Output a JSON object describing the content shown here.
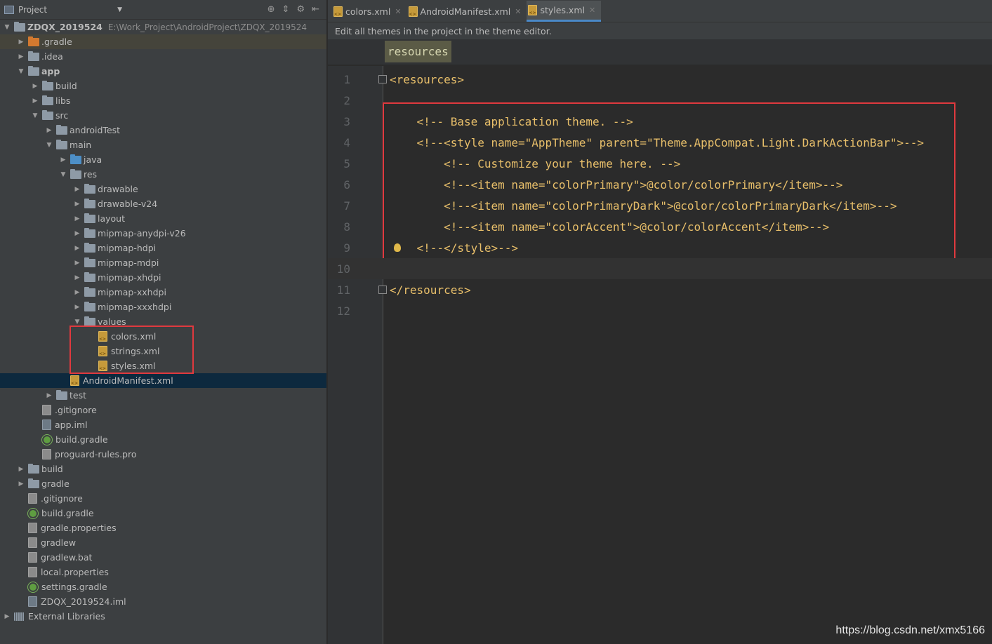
{
  "project_panel": {
    "title": "Project",
    "tree": [
      {
        "label": "ZDQX_2019524",
        "path": "E:\\Work_Project\\AndroidProject\\ZDQX_2019524",
        "depth": 0,
        "arrow": "down",
        "icon": "module",
        "bold": true
      },
      {
        "label": ".gradle",
        "depth": 1,
        "arrow": "right",
        "icon": "folder-orange",
        "highlight": true
      },
      {
        "label": ".idea",
        "depth": 1,
        "arrow": "right",
        "icon": "folder"
      },
      {
        "label": "app",
        "depth": 1,
        "arrow": "down",
        "icon": "folder-module",
        "bold": true
      },
      {
        "label": "build",
        "depth": 2,
        "arrow": "right",
        "icon": "folder"
      },
      {
        "label": "libs",
        "depth": 2,
        "arrow": "right",
        "icon": "folder"
      },
      {
        "label": "src",
        "depth": 2,
        "arrow": "down",
        "icon": "folder"
      },
      {
        "label": "androidTest",
        "depth": 3,
        "arrow": "right",
        "icon": "folder"
      },
      {
        "label": "main",
        "depth": 3,
        "arrow": "down",
        "icon": "folder"
      },
      {
        "label": "java",
        "depth": 4,
        "arrow": "right",
        "icon": "folder-blue"
      },
      {
        "label": "res",
        "depth": 4,
        "arrow": "down",
        "icon": "folder-res"
      },
      {
        "label": "drawable",
        "depth": 5,
        "arrow": "right",
        "icon": "folder"
      },
      {
        "label": "drawable-v24",
        "depth": 5,
        "arrow": "right",
        "icon": "folder"
      },
      {
        "label": "layout",
        "depth": 5,
        "arrow": "right",
        "icon": "folder"
      },
      {
        "label": "mipmap-anydpi-v26",
        "depth": 5,
        "arrow": "right",
        "icon": "folder"
      },
      {
        "label": "mipmap-hdpi",
        "depth": 5,
        "arrow": "right",
        "icon": "folder"
      },
      {
        "label": "mipmap-mdpi",
        "depth": 5,
        "arrow": "right",
        "icon": "folder"
      },
      {
        "label": "mipmap-xhdpi",
        "depth": 5,
        "arrow": "right",
        "icon": "folder"
      },
      {
        "label": "mipmap-xxhdpi",
        "depth": 5,
        "arrow": "right",
        "icon": "folder"
      },
      {
        "label": "mipmap-xxxhdpi",
        "depth": 5,
        "arrow": "right",
        "icon": "folder"
      },
      {
        "label": "values",
        "depth": 5,
        "arrow": "down",
        "icon": "folder"
      },
      {
        "label": "colors.xml",
        "depth": 6,
        "arrow": "none",
        "icon": "xml"
      },
      {
        "label": "strings.xml",
        "depth": 6,
        "arrow": "none",
        "icon": "xml"
      },
      {
        "label": "styles.xml",
        "depth": 6,
        "arrow": "none",
        "icon": "xml"
      },
      {
        "label": "AndroidManifest.xml",
        "depth": 4,
        "arrow": "none",
        "icon": "xml",
        "selected": true
      },
      {
        "label": "test",
        "depth": 3,
        "arrow": "right",
        "icon": "folder"
      },
      {
        "label": ".gitignore",
        "depth": 2,
        "arrow": "none",
        "icon": "txt"
      },
      {
        "label": "app.iml",
        "depth": 2,
        "arrow": "none",
        "icon": "iml"
      },
      {
        "label": "build.gradle",
        "depth": 2,
        "arrow": "none",
        "icon": "gradle"
      },
      {
        "label": "proguard-rules.pro",
        "depth": 2,
        "arrow": "none",
        "icon": "txt"
      },
      {
        "label": "build",
        "depth": 1,
        "arrow": "right",
        "icon": "folder"
      },
      {
        "label": "gradle",
        "depth": 1,
        "arrow": "right",
        "icon": "folder"
      },
      {
        "label": ".gitignore",
        "depth": 1,
        "arrow": "none",
        "icon": "txt"
      },
      {
        "label": "build.gradle",
        "depth": 1,
        "arrow": "none",
        "icon": "gradle"
      },
      {
        "label": "gradle.properties",
        "depth": 1,
        "arrow": "none",
        "icon": "txt"
      },
      {
        "label": "gradlew",
        "depth": 1,
        "arrow": "none",
        "icon": "txt"
      },
      {
        "label": "gradlew.bat",
        "depth": 1,
        "arrow": "none",
        "icon": "txt"
      },
      {
        "label": "local.properties",
        "depth": 1,
        "arrow": "none",
        "icon": "txt"
      },
      {
        "label": "settings.gradle",
        "depth": 1,
        "arrow": "none",
        "icon": "gradle"
      },
      {
        "label": "ZDQX_2019524.iml",
        "depth": 1,
        "arrow": "none",
        "icon": "iml"
      },
      {
        "label": "External Libraries",
        "depth": 0,
        "arrow": "right",
        "icon": "lib"
      }
    ]
  },
  "editor": {
    "tabs": [
      {
        "label": "colors.xml",
        "active": false
      },
      {
        "label": "AndroidManifest.xml",
        "active": false
      },
      {
        "label": "styles.xml",
        "active": true
      }
    ],
    "notification": "Edit all themes in the project in the theme editor.",
    "breadcrumb": "resources",
    "lines": [
      {
        "num": "1",
        "text": "<resources>",
        "kind": "tag"
      },
      {
        "num": "2",
        "text": "",
        "kind": "tag"
      },
      {
        "num": "3",
        "text": "    <!-- Base application theme. -->",
        "kind": "comment"
      },
      {
        "num": "4",
        "text": "    <!--<style name=\"AppTheme\" parent=\"Theme.AppCompat.Light.DarkActionBar\">-->",
        "kind": "comment"
      },
      {
        "num": "5",
        "text": "        <!-- Customize your theme here. -->",
        "kind": "comment"
      },
      {
        "num": "6",
        "text": "        <!--<item name=\"colorPrimary\">@color/colorPrimary</item>-->",
        "kind": "comment"
      },
      {
        "num": "7",
        "text": "        <!--<item name=\"colorPrimaryDark\">@color/colorPrimaryDark</item>-->",
        "kind": "comment"
      },
      {
        "num": "8",
        "text": "        <!--<item name=\"colorAccent\">@color/colorAccent</item>-->",
        "kind": "comment"
      },
      {
        "num": "9",
        "text": "    <!--</style>-->",
        "kind": "comment"
      },
      {
        "num": "10",
        "text": "",
        "kind": "tag",
        "current": true
      },
      {
        "num": "11",
        "text": "</resources>",
        "kind": "tag"
      },
      {
        "num": "12",
        "text": "",
        "kind": "tag"
      }
    ]
  },
  "watermark": "https://blog.csdn.net/xmx5166",
  "colors": {
    "accent_red": "#e0393e",
    "selection": "#0d293e",
    "tag": "#e8bf6a",
    "comment": "#808080"
  }
}
